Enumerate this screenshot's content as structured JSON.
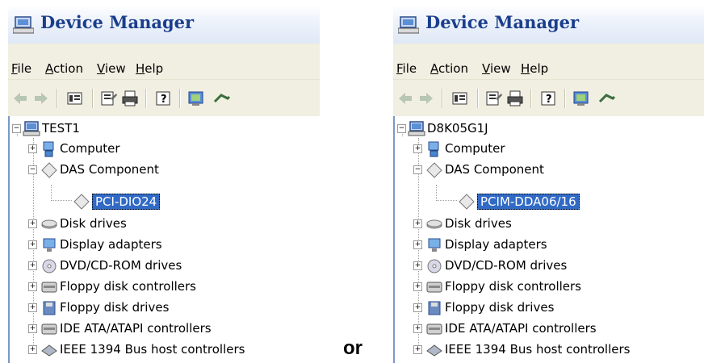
{
  "left_window": {
    "title": "Device Manager",
    "menu": [
      {
        "accel": "F",
        "rest": "ile"
      },
      {
        "accel": "A",
        "rest": "ction"
      },
      {
        "accel": "V",
        "rest": "iew"
      },
      {
        "accel": "H",
        "rest": "elp"
      }
    ],
    "root": "TEST1",
    "items": [
      {
        "label": "Computer",
        "icon": "computer-icon",
        "expander": "+"
      },
      {
        "label": "DAS Component",
        "icon": "diamond-icon",
        "expander": "−"
      },
      {
        "label": "PCI-DIO24",
        "icon": "diamond-icon",
        "selected": true
      },
      {
        "label": "Disk drives",
        "icon": "disk-drive-icon",
        "expander": "+"
      },
      {
        "label": "Display adapters",
        "icon": "monitor-icon",
        "expander": "+"
      },
      {
        "label": "DVD/CD-ROM drives",
        "icon": "cdrom-icon",
        "expander": "+"
      },
      {
        "label": "Floppy disk controllers",
        "icon": "controller-icon",
        "expander": "+"
      },
      {
        "label": "Floppy disk drives",
        "icon": "floppy-icon",
        "expander": "+"
      },
      {
        "label": "IDE ATA/ATAPI controllers",
        "icon": "controller-icon",
        "expander": "+"
      },
      {
        "label": "IEEE 1394 Bus host controllers",
        "icon": "ieee1394-icon",
        "expander": "+"
      }
    ]
  },
  "separator_text": "or",
  "right_window": {
    "title": "Device Manager",
    "menu": [
      {
        "accel": "F",
        "rest": "ile"
      },
      {
        "accel": "A",
        "rest": "ction"
      },
      {
        "accel": "V",
        "rest": "iew"
      },
      {
        "accel": "H",
        "rest": "elp"
      }
    ],
    "root": "D8K05G1J",
    "items": [
      {
        "label": "Computer",
        "icon": "computer-icon",
        "expander": "+"
      },
      {
        "label": "DAS Component",
        "icon": "diamond-icon",
        "expander": "−"
      },
      {
        "label": "PCIM-DDA06/16",
        "icon": "diamond-icon",
        "selected": true
      },
      {
        "label": "Disk drives",
        "icon": "disk-drive-icon",
        "expander": "+"
      },
      {
        "label": "Display adapters",
        "icon": "monitor-icon",
        "expander": "+"
      },
      {
        "label": "DVD/CD-ROM drives",
        "icon": "cdrom-icon",
        "expander": "+"
      },
      {
        "label": "Floppy disk controllers",
        "icon": "controller-icon",
        "expander": "+"
      },
      {
        "label": "Floppy disk drives",
        "icon": "floppy-icon",
        "expander": "+"
      },
      {
        "label": "IDE ATA/ATAPI controllers",
        "icon": "controller-icon",
        "expander": "+"
      },
      {
        "label": "IEEE 1394 Bus host controllers",
        "icon": "ieee1394-icon",
        "expander": "+"
      }
    ]
  },
  "colors": {
    "title_text": "#1a3e8c",
    "menu_bg": "#f1efe2",
    "selection": "#316ac5"
  }
}
